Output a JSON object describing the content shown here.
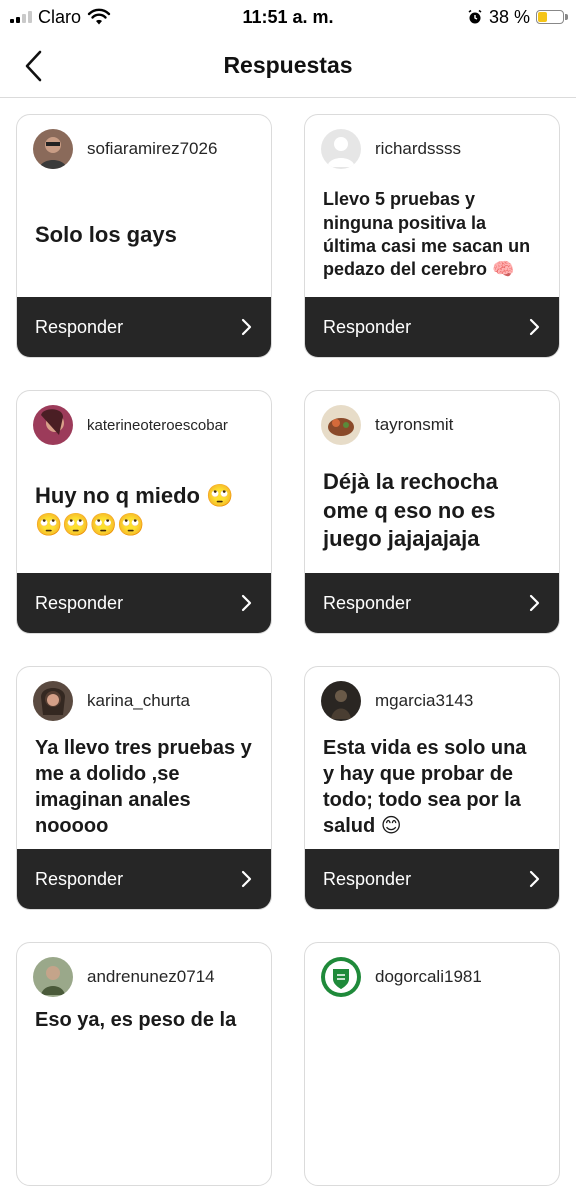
{
  "status_bar": {
    "carrier": "Claro",
    "time": "11:51 a. m.",
    "battery": "38 %",
    "battery_level": 0.38,
    "icons": [
      "signal-icon",
      "wifi-icon",
      "alarm-icon",
      "battery-icon"
    ]
  },
  "header": {
    "title": "Respuestas",
    "back_icon": "chevron-left-icon"
  },
  "cards": [
    {
      "username": "sofiaramirez7026",
      "text": "Solo los gays",
      "avatar_color": "#8a6a5a"
    },
    {
      "username": "richardssss",
      "text": "Llevo 5 pruebas y ninguna positiva la última casi me sacan un pedazo del cerebro 🧠",
      "avatar_color": "#d8d8d8"
    },
    {
      "username": "katerineoteroescobar",
      "text": "Huy  no   q miedo 🙄🙄🙄🙄🙄",
      "avatar_color": "#9c3b5a"
    },
    {
      "username": "tayronsmit",
      "text": "Déjà la rechocha ome q eso no es juego jajajajaja",
      "avatar_color": "#6b4a3a"
    },
    {
      "username": "karina_churta",
      "text": "Ya llevo tres pruebas y me a dolido ,se imaginan anales nooooo",
      "avatar_color": "#5a4a40"
    },
    {
      "username": "mgarcia3143",
      "text": "Esta vida es solo una y hay que probar de todo; todo sea por la salud 😊",
      "avatar_color": "#2a2622"
    },
    {
      "username": "andrenunez0714",
      "text": "Eso ya, es peso de la",
      "avatar_color": "#6f7a60"
    },
    {
      "username": "dogorcali1981",
      "text": "",
      "avatar_color": "#1f8a3a"
    }
  ],
  "reply_label": "Responder",
  "colors": {
    "footer_bg": "#262626",
    "border": "#dbdbdb",
    "battery_fill": "#f5c518"
  }
}
